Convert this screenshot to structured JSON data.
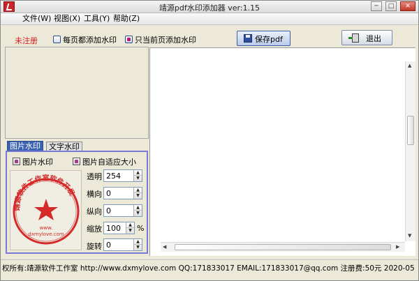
{
  "window": {
    "title": "靖源pdf水印添加器 ver:1.15",
    "minimize": "─",
    "maximize": "□",
    "close": "✕"
  },
  "menu": [
    {
      "label": "文件(W)"
    },
    {
      "label": "视图(X)"
    },
    {
      "label": "工具(Y)"
    },
    {
      "label": "帮助(Z)"
    }
  ],
  "toolbar": {
    "unregistered_label": "未注册",
    "every_page_label": "每页都添加水印",
    "every_page_checked": false,
    "current_page_label": "只当前页添加水印",
    "current_page_checked": true,
    "save_label": "保存pdf",
    "exit_label": "退出"
  },
  "tabs": {
    "image_tab": "图片水印",
    "text_tab": "文字水印",
    "active": "image_tab"
  },
  "image_panel": {
    "image_watermark_label": "图片水印",
    "image_watermark_checked": true,
    "auto_size_label": "图片自适应大小",
    "auto_size_checked": true,
    "fields": [
      {
        "label": "透明",
        "value": "254"
      },
      {
        "label": "横向",
        "value": "0"
      },
      {
        "label": "纵向",
        "value": "0"
      },
      {
        "label": "缩放",
        "value": "100",
        "unit": "%"
      },
      {
        "label": "旋转",
        "value": "0"
      }
    ]
  },
  "stamp": {
    "arc_text": "靖源软件工作室软件开发",
    "url_text": "www.",
    "url_text2": "dxmylove.com",
    "color": "#d42a2a"
  },
  "statusbar": {
    "text": "权所有:靖源软件工作室 http://www.dxmylove.com QQ:171833017 EMAIL:171833017@qq.com 注册费:50元 2020-05"
  },
  "colors": {
    "accent": "#3a62b0",
    "unregistered": "#d81c1c",
    "tab_border": "#7a7ad4"
  }
}
